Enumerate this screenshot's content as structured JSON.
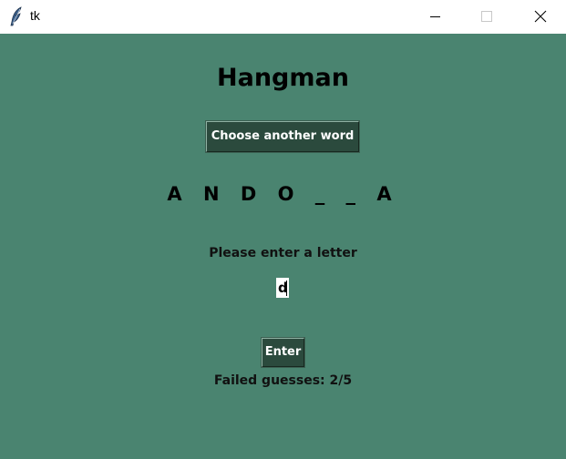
{
  "window": {
    "title": "tk",
    "icon": "feather-icon",
    "background": "#4a8470"
  },
  "game": {
    "title": "Hangman",
    "choose_button_label": "Choose another word",
    "word_display": "A N D O _ _ A",
    "prompt": "Please enter a letter",
    "letter_input_value": "d",
    "enter_button_label": "Enter",
    "failed_guesses_text": "Failed guesses: 2/5",
    "failed_guesses": 2,
    "max_guesses": 5
  },
  "colors": {
    "button_bg": "#2b4a3d",
    "button_text": "#ffffff",
    "text": "#000000"
  }
}
